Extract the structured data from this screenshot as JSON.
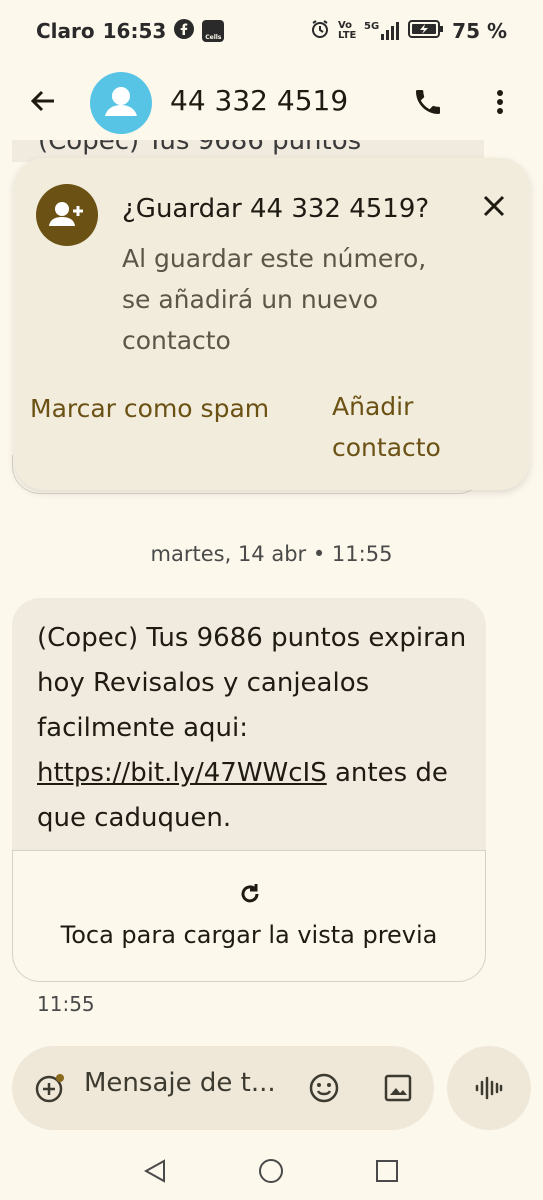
{
  "status_bar": {
    "carrier": "Claro",
    "time": "16:53",
    "notif_app_label": "Cells",
    "volte_label": "Vo LTE",
    "network_type": "5G",
    "battery_percent": "75 %"
  },
  "header": {
    "contact_number": "44 332 4519",
    "icons": [
      "back-arrow-icon",
      "avatar-person-icon",
      "phone-icon",
      "more-vert-icon"
    ]
  },
  "previous_message_fragment": "(Copec) Tus 9686 puntos",
  "save_banner": {
    "title": "¿Guardar 44 332 4519?",
    "body": "Al guardar este número, se añadirá un nuevo contacto",
    "spam_label": "Marcar como spam",
    "add_label": "Añadir contacto",
    "icon": "add-person-icon",
    "accent_color": "#6b5214"
  },
  "conversation": {
    "date_divider": "martes, 14 abr • 11:55",
    "message": {
      "text_before": "(Copec) Tus 9686 puntos expiran hoy Revisalos y canjealos facilmente aqui: ",
      "link": "https://bit.ly/47WWcIS",
      "text_after": " antes de que caduquen.",
      "preview_label": "Toca para cargar la vista previa",
      "time": "11:55"
    }
  },
  "composer": {
    "placeholder": "Mensaje de t...",
    "icons": [
      "add-attachment-icon",
      "emoji-icon",
      "gallery-icon",
      "voice-waveform-icon"
    ]
  },
  "nav_bar": {
    "icons": [
      "nav-back-icon",
      "nav-home-icon",
      "nav-recents-icon"
    ]
  }
}
